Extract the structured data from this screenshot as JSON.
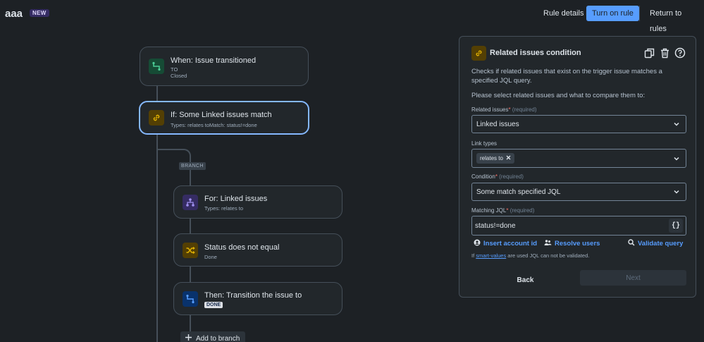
{
  "rule": {
    "name": "aaa",
    "badge": "NEW"
  },
  "header": {
    "rule_details": "Rule details",
    "turn_on": "Turn on rule",
    "return": "Return to rules"
  },
  "flow": {
    "trigger": {
      "title": "When: Issue transitioned",
      "line1": "TO",
      "line2": "Closed"
    },
    "condition": {
      "title": "If: Some Linked issues match",
      "sub": "Types: relates toMatch: status!=done"
    },
    "branch_label": "BRANCH",
    "branch_for": {
      "title": "For: Linked issues",
      "sub": "Types: relates to"
    },
    "status_cond": {
      "title": "Status does not equal",
      "sub": "Done"
    },
    "transition": {
      "title": "Then: Transition the issue to",
      "status": "DONE"
    },
    "add_branch": "Add to branch"
  },
  "panel": {
    "title": "Related issues condition",
    "description": "Checks if related issues that exist on the trigger issue matches a specified JQL query.",
    "prompt": "Please select related issues and what to compare them to:",
    "related": {
      "label": "Related issues",
      "required": "(required)",
      "value": "Linked issues"
    },
    "link_types": {
      "label": "Link types",
      "chip": "relates to"
    },
    "condition": {
      "label": "Condition",
      "required": "(required)",
      "value": "Some match specified JQL"
    },
    "jql": {
      "label": "Matching JQL",
      "required": "(required)",
      "value": "status!=done",
      "button": "{}"
    },
    "actions": {
      "insert": "Insert account id",
      "resolve": "Resolve users",
      "validate": "Validate query"
    },
    "note": {
      "prefix": "If ",
      "link": "smart-values",
      "suffix": " are used JQL can not be validated."
    },
    "back": "Back",
    "next": "Next"
  },
  "colors": {
    "accent": "#579dff",
    "background": "#1d2125",
    "card": "#22272b",
    "selected_border": "#85b8ff"
  },
  "icons": {
    "trigger": "transition-icon",
    "condition": "link-icon",
    "branch": "hierarchy-icon",
    "status": "shuffle-icon",
    "action": "transition-icon",
    "copy": "copy-icon",
    "delete": "trash-icon",
    "help": "help-icon"
  }
}
